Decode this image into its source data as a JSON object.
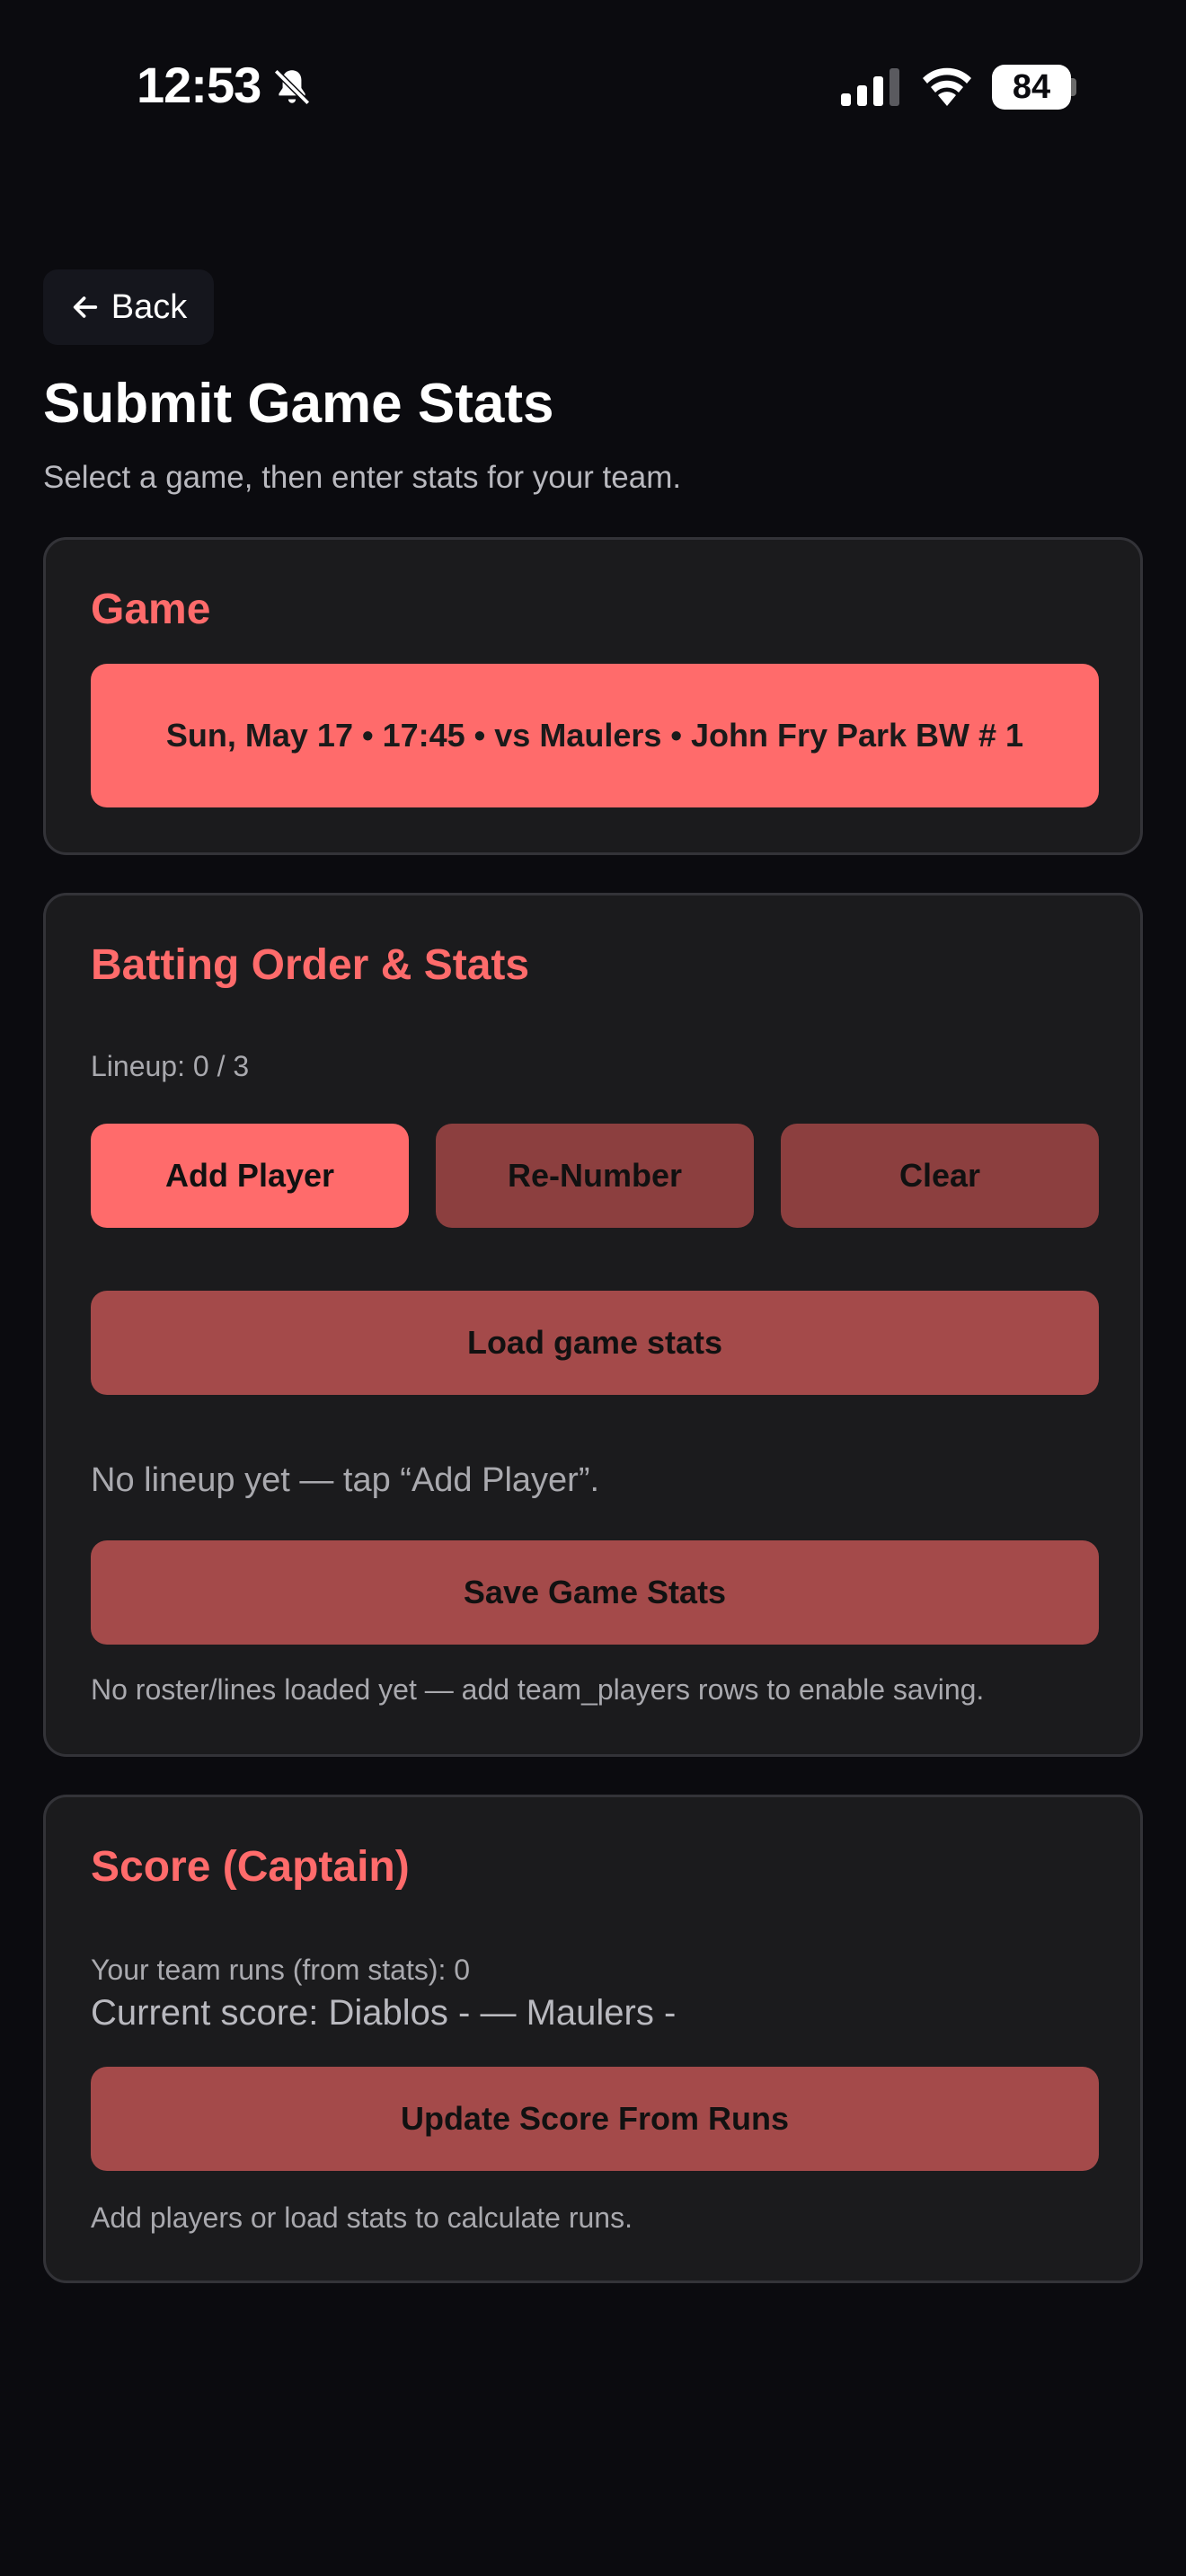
{
  "status_bar": {
    "time": "12:53",
    "battery": "84",
    "icons": [
      "bell-slash-icon",
      "signal-icon",
      "wifi-icon",
      "battery-icon"
    ]
  },
  "header": {
    "back_label": "Back",
    "title": "Submit Game Stats",
    "subtitle": "Select a game, then enter stats for your team."
  },
  "game_card": {
    "title": "Game",
    "selected_game": "Sun, May 17 • 17:45 • vs Maulers • John Fry Park BW # 1"
  },
  "batting_card": {
    "title": "Batting Order & Stats",
    "lineup": "Lineup: 0 / 3",
    "add_player": "Add Player",
    "renumber": "Re-Number",
    "clear": "Clear",
    "load_stats": "Load game stats",
    "empty_message": "No lineup yet — tap “Add Player”.",
    "save": "Save Game Stats",
    "note": "No roster/lines loaded yet — add team_players rows to enable saving."
  },
  "score_card": {
    "title": "Score (Captain)",
    "team_runs": "Your team runs (from stats): 0",
    "current_score": "Current score: Diablos - — Maulers -",
    "update_button": "Update Score From Runs",
    "note": "Add players or load stats to calculate runs."
  },
  "colors": {
    "accent": "#ff6b6b",
    "button_dim": "#8c3f3f",
    "button_wide": "#a44a4a",
    "card_bg": "#1b1b1d",
    "page_bg": "#0b0b0f"
  }
}
